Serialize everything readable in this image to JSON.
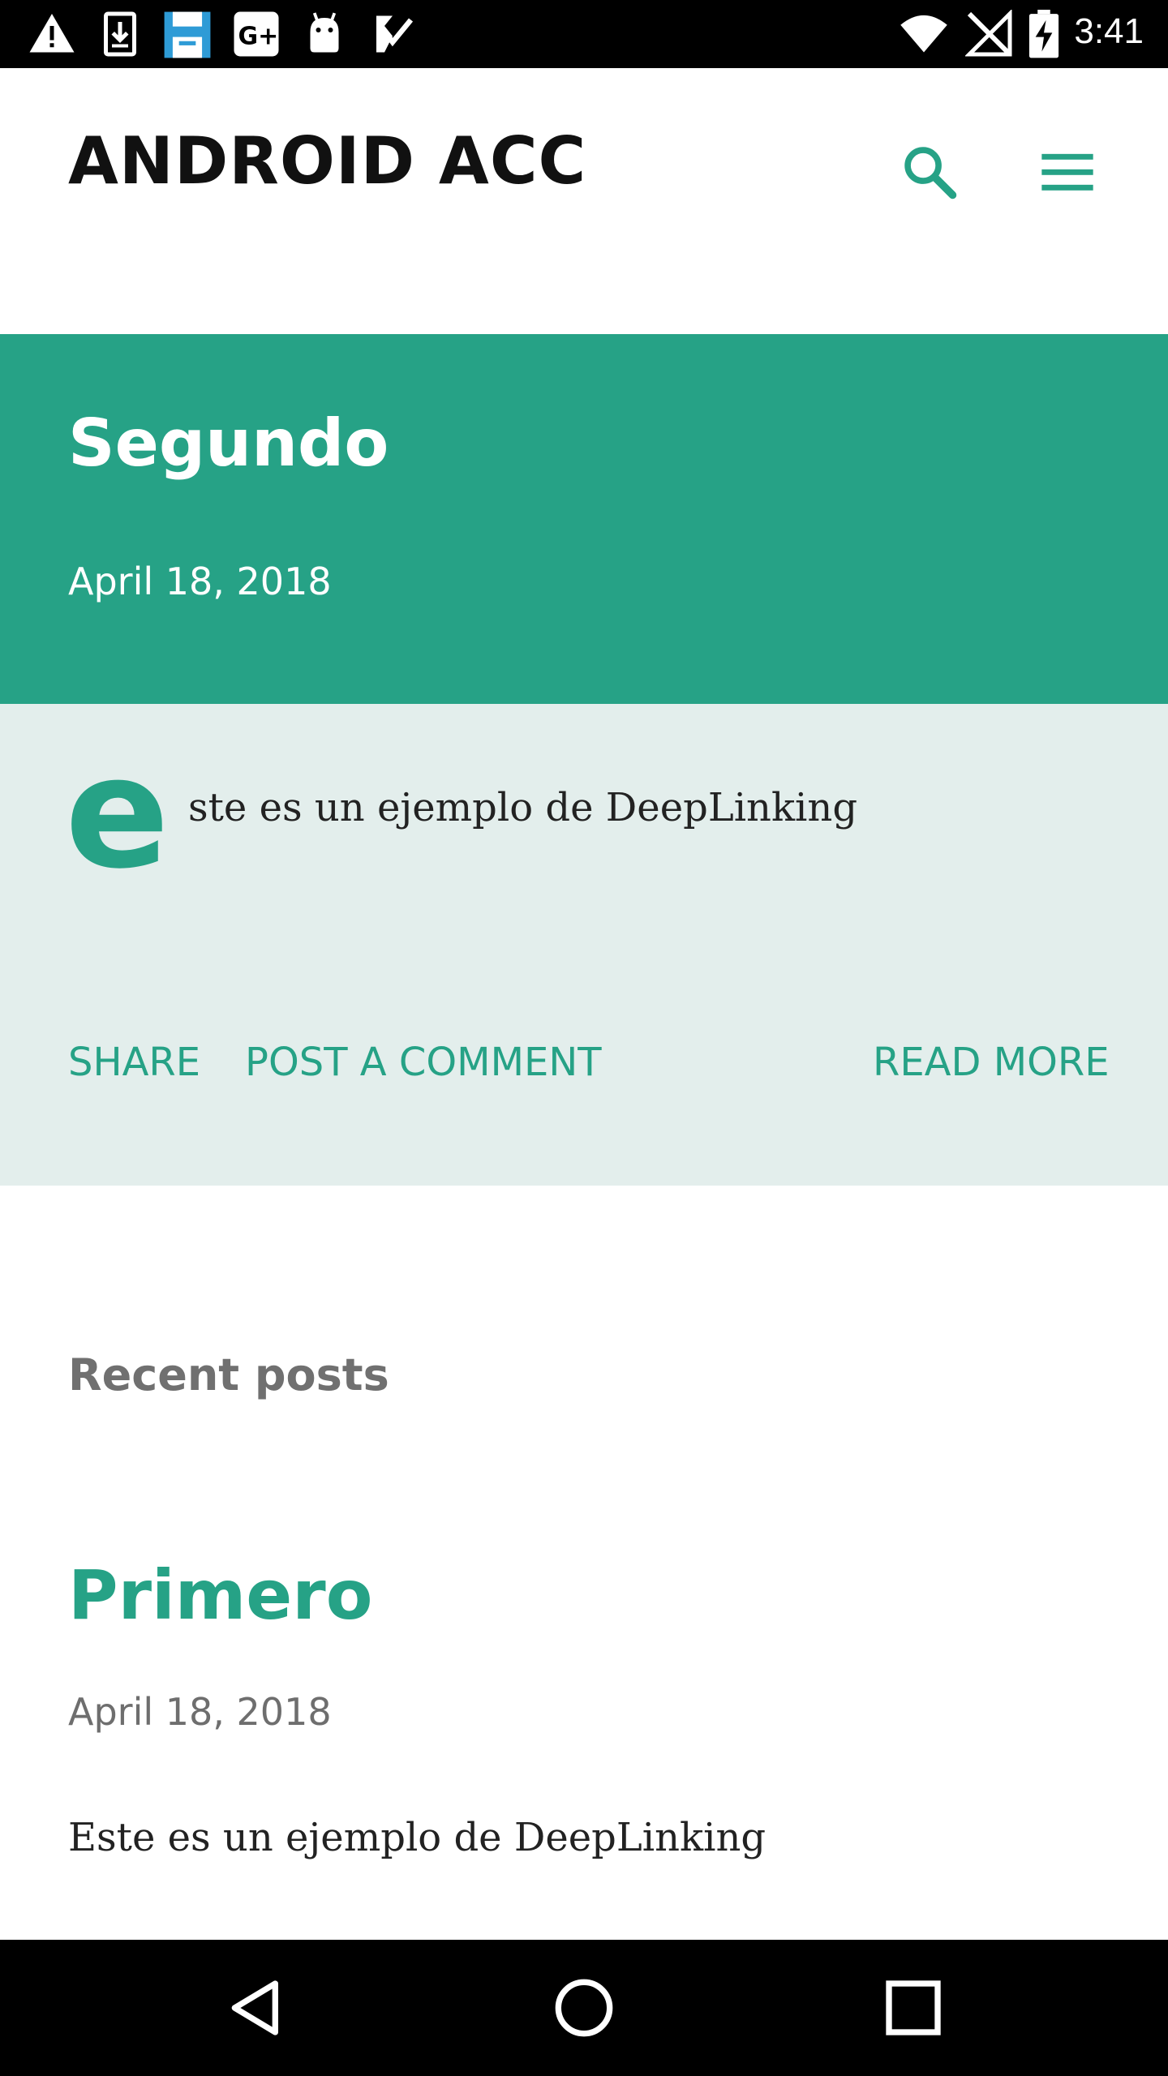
{
  "status_bar": {
    "time": "3:41",
    "left_icons": [
      "warning-icon",
      "download-icon",
      "save-icon",
      "google-plus-icon",
      "android-icon",
      "check-task-icon"
    ],
    "right_icons": [
      "wifi-icon",
      "no-signal-icon",
      "battery-charging-icon"
    ]
  },
  "header": {
    "title": "ANDROID ACC",
    "search_icon": "search-icon",
    "menu_icon": "menu-icon"
  },
  "featured_post": {
    "title": "Segundo",
    "date": "April 18, 2018",
    "drop_cap": "e",
    "snippet": "ste es un ejemplo de DeepLinking",
    "actions": {
      "share": "SHARE",
      "comment": "POST A COMMENT",
      "read_more": "READ MORE"
    }
  },
  "recent": {
    "heading": "Recent posts",
    "posts": [
      {
        "title": "Primero",
        "date": "April 18, 2018",
        "snippet": "Este es un ejemplo de DeepLinking"
      }
    ]
  },
  "nav_bar": {
    "buttons": [
      "back-icon",
      "home-icon",
      "recents-icon"
    ]
  },
  "colors": {
    "accent": "#26a286",
    "body_tint": "#e3eeec",
    "muted_text": "#707070"
  }
}
